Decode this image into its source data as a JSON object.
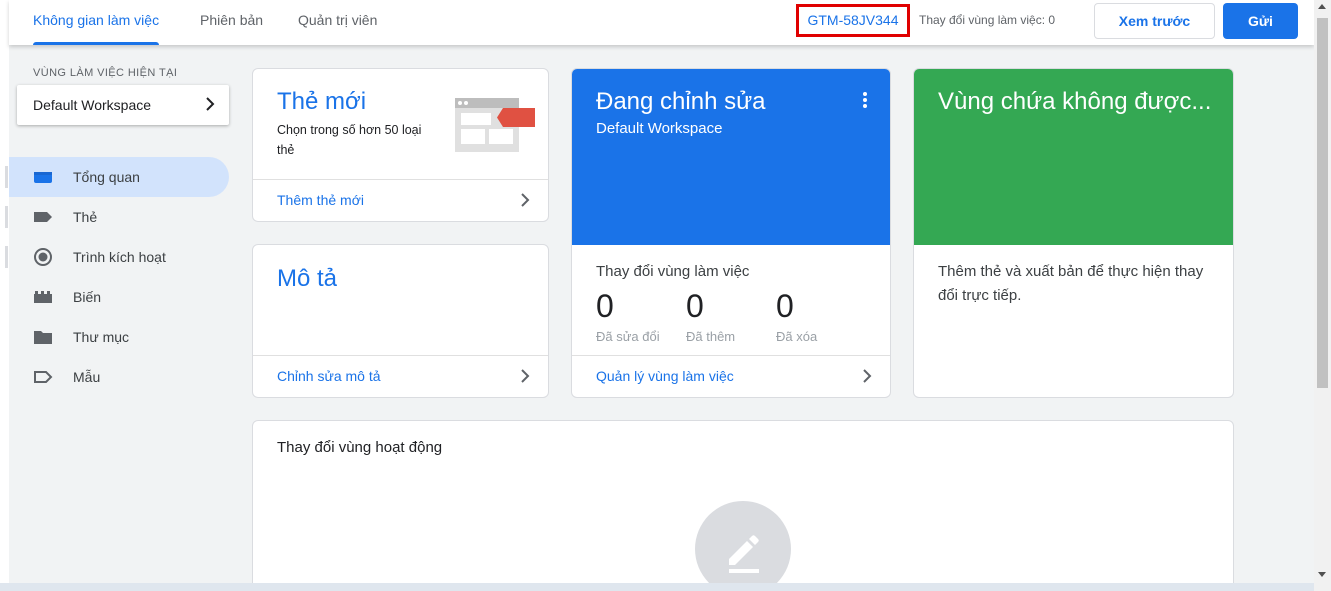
{
  "header": {
    "tabs": [
      {
        "label": "Không gian làm việc",
        "active": true
      },
      {
        "label": "Phiên bản",
        "active": false
      },
      {
        "label": "Quản trị viên",
        "active": false
      }
    ],
    "container_id": "GTM-58JV344",
    "workspace_changes": "Thay đổi vùng làm việc: 0",
    "preview_label": "Xem trước",
    "submit_label": "Gửi"
  },
  "sidebar": {
    "current_workspace_label": "VÙNG LÀM VIỆC HIỆN TẠI",
    "workspace_name": "Default Workspace",
    "items": [
      {
        "label": "Tổng quan",
        "icon": "overview-icon",
        "active": true
      },
      {
        "label": "Thẻ",
        "icon": "tag-icon",
        "active": false
      },
      {
        "label": "Trình kích hoạt",
        "icon": "trigger-icon",
        "active": false
      },
      {
        "label": "Biến",
        "icon": "variable-icon",
        "active": false
      },
      {
        "label": "Thư mục",
        "icon": "folder-icon",
        "active": false
      },
      {
        "label": "Mẫu",
        "icon": "template-icon",
        "active": false
      }
    ]
  },
  "cards": {
    "new_tag": {
      "title": "Thẻ mới",
      "description": "Chọn trong số hơn 50 loại thẻ",
      "link": "Thêm thẻ mới"
    },
    "description": {
      "title": "Mô tả",
      "link": "Chỉnh sửa mô tả"
    },
    "editing": {
      "title": "Đang chỉnh sửa",
      "subtitle": "Default Workspace",
      "changes_title": "Thay đổi vùng làm việc",
      "stats": [
        {
          "value": "0",
          "label": "Đã sửa đổi"
        },
        {
          "value": "0",
          "label": "Đã thêm"
        },
        {
          "value": "0",
          "label": "Đã xóa"
        }
      ],
      "link": "Quản lý vùng làm việc"
    },
    "live": {
      "title": "Vùng chứa không được...",
      "description": "Thêm thẻ và xuất bản để thực hiện thay đổi trực tiếp."
    },
    "activity": {
      "title": "Thay đổi vùng hoạt động"
    }
  },
  "colors": {
    "accent": "#1a73e8",
    "live": "#34a853",
    "highlight_border": "#e00000"
  }
}
